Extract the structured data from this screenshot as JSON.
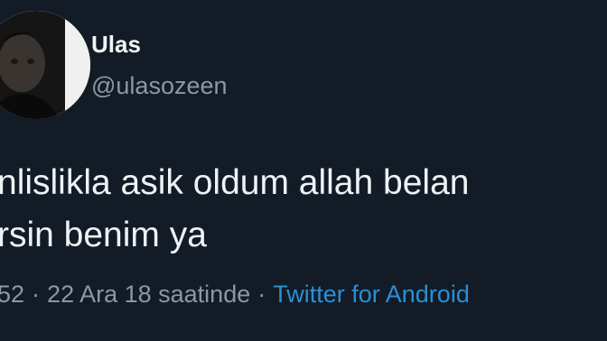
{
  "author": {
    "name": "Ulas",
    "handle": "@ulasozeen"
  },
  "tweet": {
    "lines": [
      "nlislikla asik oldum allah belan",
      "rsin benim ya"
    ]
  },
  "meta": {
    "time": "52",
    "separator": "·",
    "date": "22 Ara 18 saatinde",
    "source": "Twitter for Android"
  },
  "colors": {
    "background": "#131c26",
    "link": "#2b8ed6",
    "secondary_text": "#8a98a6"
  }
}
